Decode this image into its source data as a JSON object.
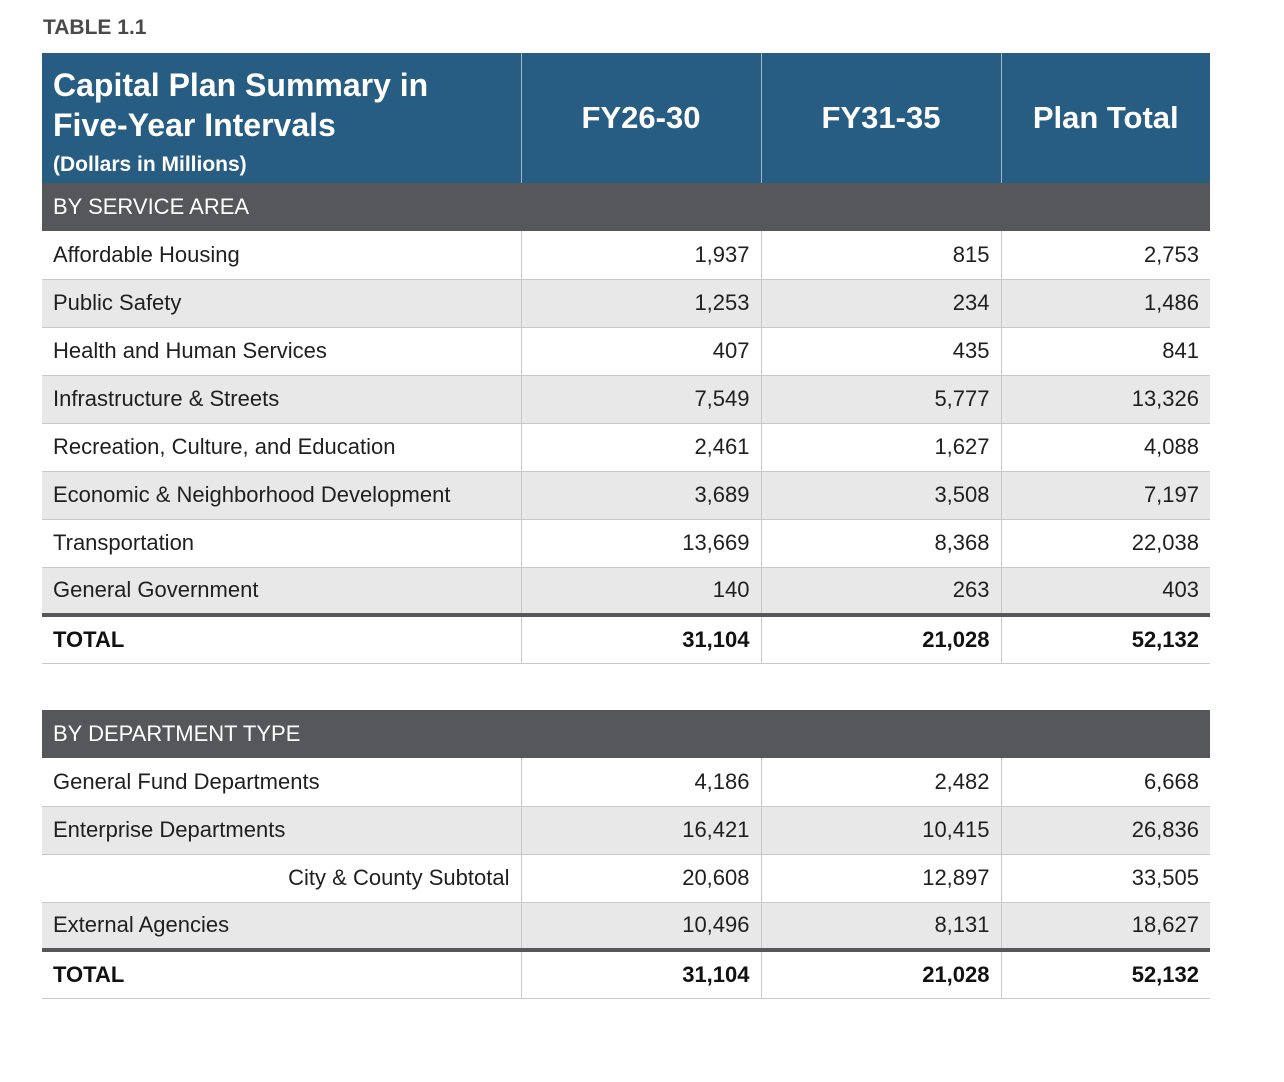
{
  "table_label": "TABLE 1.1",
  "header": {
    "title_line1": "Capital Plan Summary in",
    "title_line2": "Five-Year Intervals",
    "subtitle": "(Dollars in Millions)",
    "col_fy1": "FY26-30",
    "col_fy2": "FY31-35",
    "col_total": "Plan Total"
  },
  "service_area": {
    "heading": "BY SERVICE AREA",
    "rows": [
      {
        "label": "Affordable Housing",
        "fy1": "1,937",
        "fy2": "815",
        "total": "2,753"
      },
      {
        "label": "Public Safety",
        "fy1": "1,253",
        "fy2": "234",
        "total": "1,486"
      },
      {
        "label": "Health and Human Services",
        "fy1": "407",
        "fy2": "435",
        "total": "841"
      },
      {
        "label": "Infrastructure & Streets",
        "fy1": "7,549",
        "fy2": "5,777",
        "total": "13,326"
      },
      {
        "label": "Recreation, Culture, and Education",
        "fy1": "2,461",
        "fy2": "1,627",
        "total": "4,088"
      },
      {
        "label": "Economic & Neighborhood Development",
        "fy1": "3,689",
        "fy2": "3,508",
        "total": "7,197"
      },
      {
        "label": "Transportation",
        "fy1": "13,669",
        "fy2": "8,368",
        "total": "22,038"
      },
      {
        "label": "General Government",
        "fy1": "140",
        "fy2": "263",
        "total": "403"
      }
    ],
    "total": {
      "label": "TOTAL",
      "fy1": "31,104",
      "fy2": "21,028",
      "total": "52,132"
    }
  },
  "department_type": {
    "heading": "BY DEPARTMENT TYPE",
    "rows": [
      {
        "label": "General Fund Departments",
        "fy1": "4,186",
        "fy2": "2,482",
        "total": "6,668"
      },
      {
        "label": "Enterprise Departments",
        "fy1": "16,421",
        "fy2": "10,415",
        "total": "26,836"
      },
      {
        "label": "City & County Subtotal",
        "fy1": "20,608",
        "fy2": "12,897",
        "total": "33,505"
      },
      {
        "label": "External Agencies",
        "fy1": "10,496",
        "fy2": "8,131",
        "total": "18,627"
      }
    ],
    "total": {
      "label": "TOTAL",
      "fy1": "31,104",
      "fy2": "21,028",
      "total": "52,132"
    }
  },
  "colors": {
    "header_blue": "#275d82",
    "section_gray": "#56575b",
    "alt_row": "#e8e8e8"
  }
}
